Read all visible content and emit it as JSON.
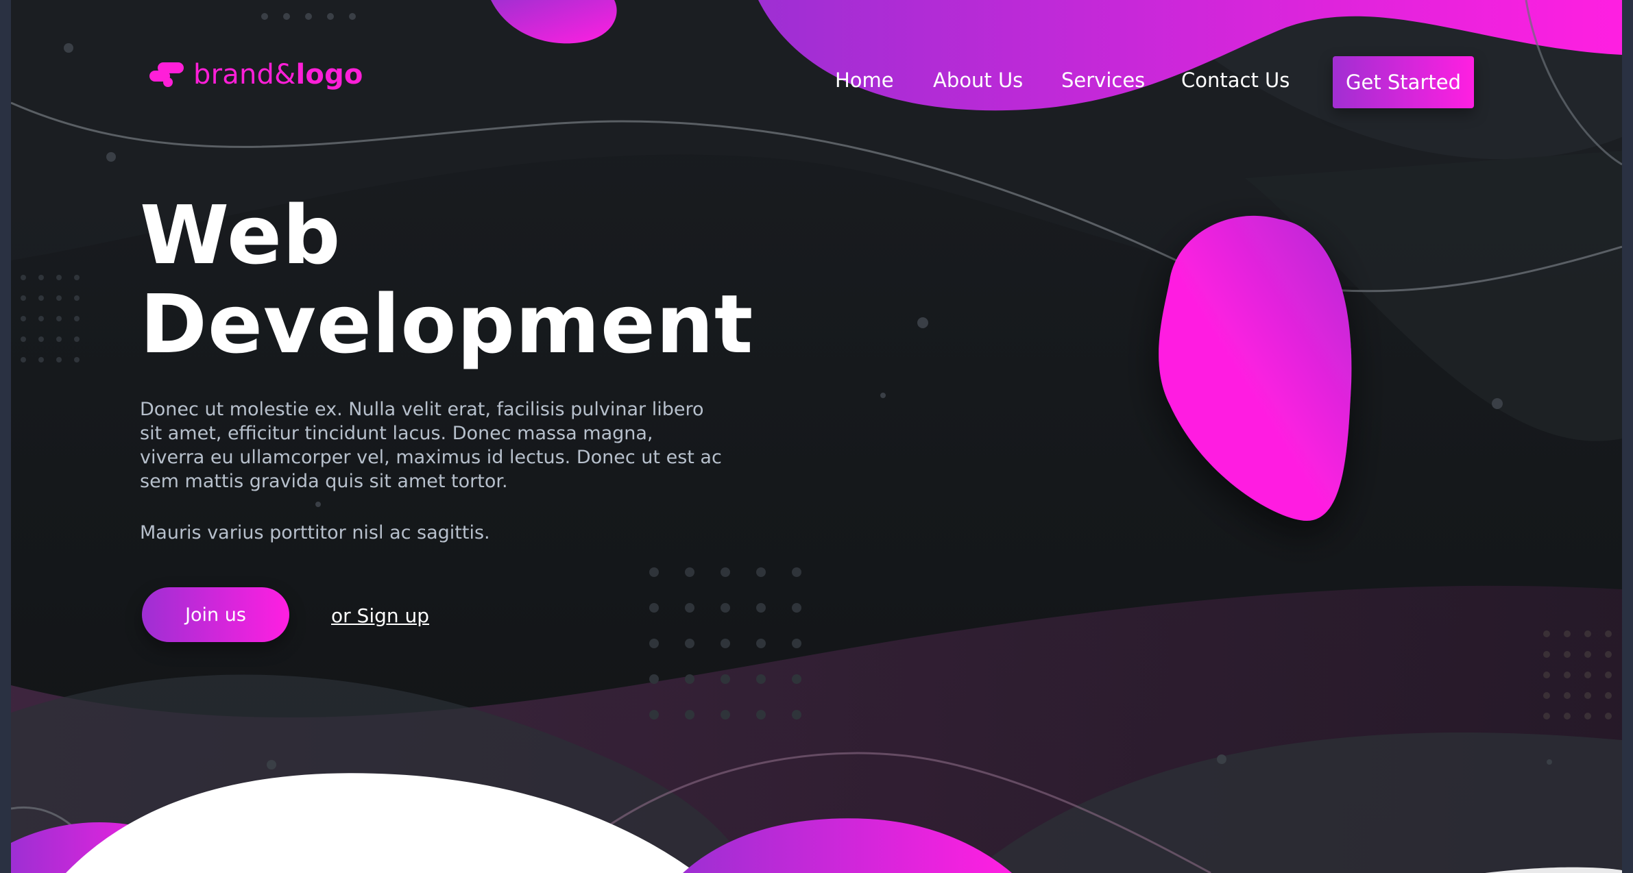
{
  "brand": {
    "logo_text_regular": "brand&",
    "logo_text_bold": "logo",
    "color": "#ff1fd8"
  },
  "nav": {
    "items": [
      {
        "label": "Home"
      },
      {
        "label": "About Us"
      },
      {
        "label": "Services"
      },
      {
        "label": "Contact Us"
      }
    ],
    "cta_label": "Get Started"
  },
  "hero": {
    "title_line1": "Web",
    "title_line2": "Development",
    "paragraph1": "Donec ut molestie ex. Nulla velit erat, facilisis pulvinar libero sit amet, efficitur tincidunt lacus. Donec massa magna, viverra eu ullamcorper vel, maximus id lectus. Donec ut est ac sem mattis gravida quis sit amet tortor.",
    "paragraph2": "Mauris varius porttitor nisl ac sagittis.",
    "join_label": "Join us",
    "signup_label": "or Sign up"
  },
  "colors": {
    "accent_pink": "#ff1fe1",
    "accent_purple": "#9e2fd3",
    "background_dark": "#16191c",
    "body_text": "#b7c0cc"
  }
}
